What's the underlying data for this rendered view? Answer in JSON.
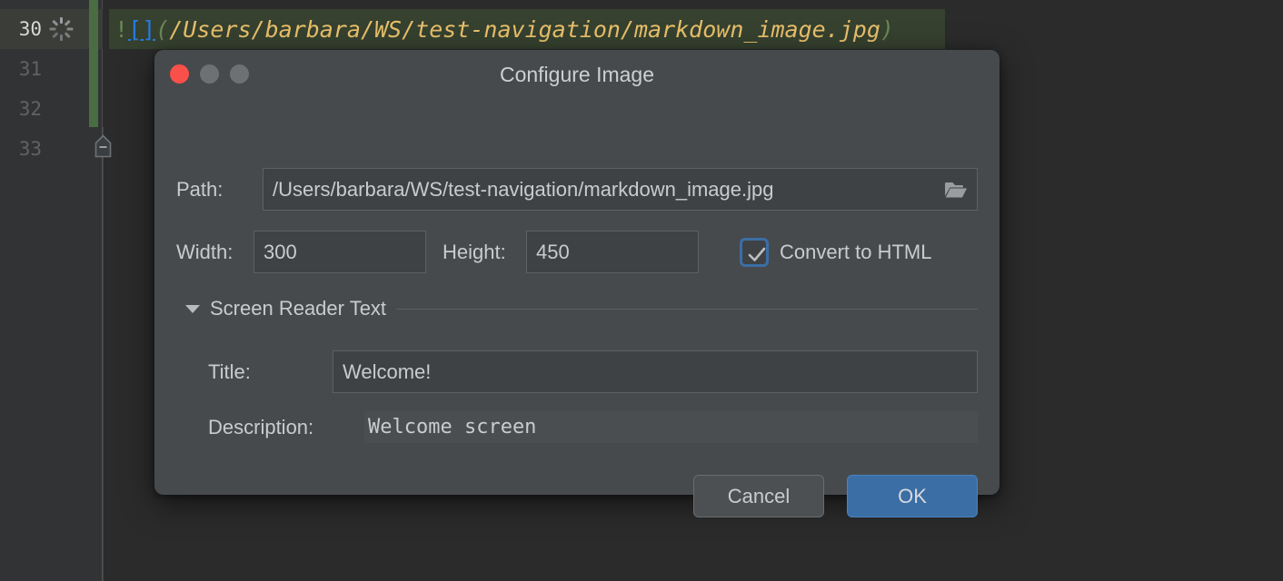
{
  "editor": {
    "line_numbers": [
      "30",
      "31",
      "32",
      "33"
    ],
    "active_line_number": "30",
    "gutter_icon": "loading-spinner-icon",
    "fold_marker_icon": "fold-collapse-icon",
    "change_marker_color": "#4a6c43",
    "code_line": {
      "prefix": "!",
      "brackets": "[]",
      "open_paren": "(",
      "path": "/Users/barbara/WS/test-navigation/markdown_image.jpg",
      "close_paren": ")"
    },
    "colors": {
      "background": "#2b2b2b",
      "gutter": "#313335",
      "line_highlight": "#36412f",
      "link_blue": "#287bde",
      "string_yellow": "#e8bf6a",
      "markup_green": "#6a8759"
    }
  },
  "dialog": {
    "title": "Configure Image",
    "window_controls": {
      "close": "close-button",
      "minimize": "minimize-button",
      "zoom": "zoom-button"
    },
    "path": {
      "label": "Path:",
      "value": "/Users/barbara/WS/test-navigation/markdown_image.jpg",
      "browse_icon": "folder-open-icon"
    },
    "width": {
      "label": "Width:",
      "value": "300"
    },
    "height": {
      "label": "Height:",
      "value": "450"
    },
    "convert_to_html": {
      "label": "Convert to HTML",
      "checked": true
    },
    "screen_reader_section": {
      "title": "Screen Reader Text",
      "expanded": true,
      "caret_icon": "chevron-down-icon"
    },
    "screen_reader_title": {
      "label": "Title:",
      "value": "Welcome!"
    },
    "screen_reader_description": {
      "label": "Description:",
      "value": "Welcome screen"
    },
    "buttons": {
      "cancel": "Cancel",
      "ok": "OK"
    },
    "colors": {
      "surface": "#474a4d",
      "field": "#3f4245",
      "accent": "#3b6ea5",
      "close_red": "#f9504a"
    }
  }
}
